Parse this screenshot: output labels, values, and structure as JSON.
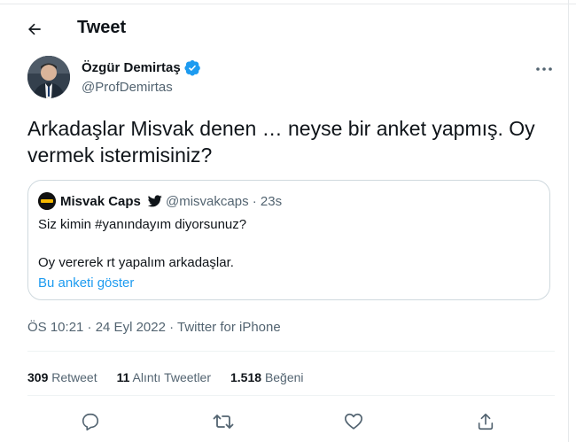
{
  "header": {
    "title": "Tweet",
    "back_icon": "arrow-left-icon"
  },
  "author": {
    "name": "Özgür Demirtaş",
    "handle": "@ProfDemirtas",
    "verified": true,
    "verified_color": "#1d9bf0"
  },
  "tweet": {
    "text": "Arkadaşlar Misvak denen … neyse bir anket yapmış. Oy vermek istermisiniz?"
  },
  "quoted": {
    "avatar_text": "Misvak",
    "name": "Misvak Caps",
    "badge_icon": "bird-icon",
    "handle": "@misvakcaps · 23s",
    "line1": "Siz kimin #yanındayım diyorsunuz?",
    "line2": "Oy vererek rt yapalım arkadaşlar.",
    "poll_link": "Bu anketi göster"
  },
  "meta": {
    "text": "ÖS 10:21 · 24 Eyl 2022 · Twitter for iPhone"
  },
  "stats": {
    "retweets_count": "309",
    "retweets_label": "Retweet",
    "quotes_count": "11",
    "quotes_label": "Alıntı Tweetler",
    "likes_count": "1.518",
    "likes_label": "Beğeni"
  },
  "actions": [
    "reply-icon",
    "retweet-icon",
    "like-icon",
    "share-icon"
  ],
  "colors": {
    "accent": "#1d9bf0",
    "text": "#0f1419",
    "muted": "#536471"
  }
}
